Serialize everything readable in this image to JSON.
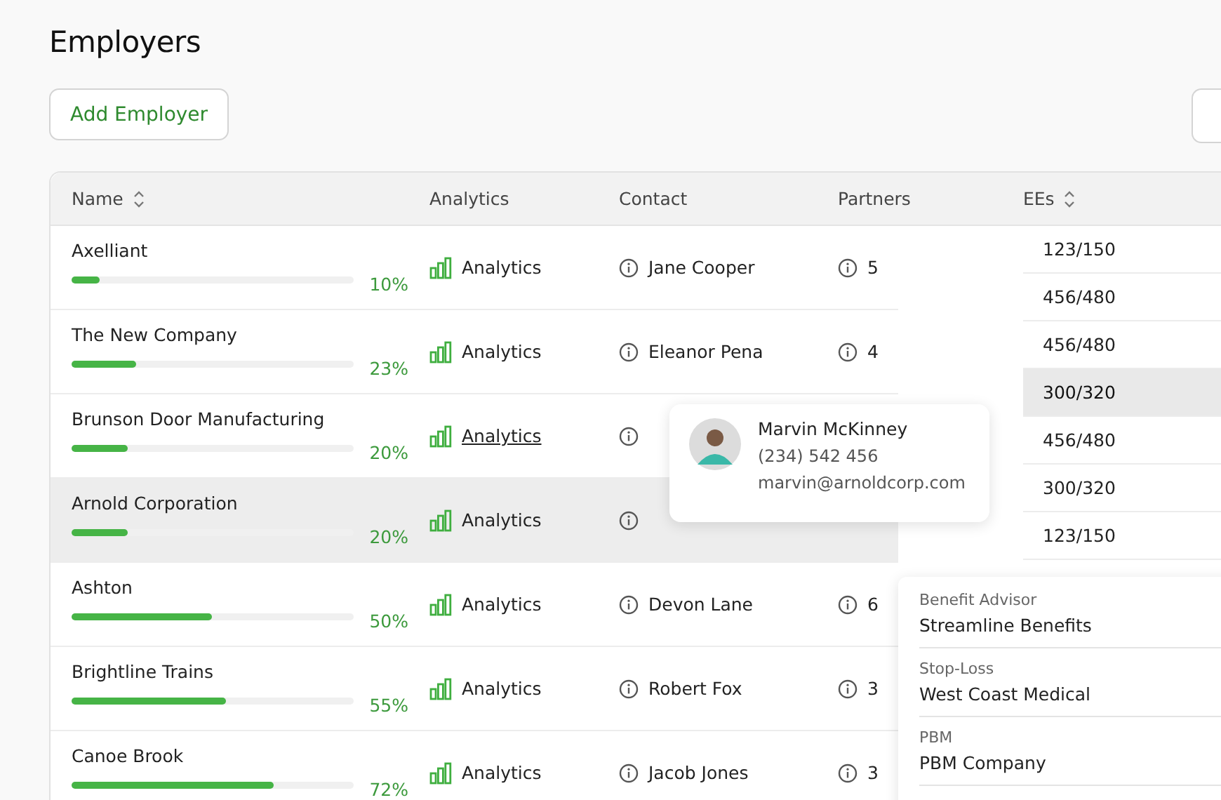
{
  "title": "Employers",
  "add_button": "Add Employer",
  "columns": [
    {
      "label": "Name",
      "sortable": true
    },
    {
      "label": "Analytics",
      "sortable": false
    },
    {
      "label": "Contact",
      "sortable": false
    },
    {
      "label": "Partners",
      "sortable": false
    },
    {
      "label": "EEs",
      "sortable": true
    }
  ],
  "rows": [
    {
      "name": "Axelliant",
      "level": 0.1,
      "percent": "10%",
      "analytics": "Analytics",
      "hovered": false,
      "contact": "Jane Cooper",
      "partners": "5",
      "selected": false
    },
    {
      "name": "The New Company",
      "level": 0.23,
      "percent": "23%",
      "analytics": "Analytics",
      "hovered": false,
      "contact": "Eleanor Pena",
      "partners": "4",
      "selected": false
    },
    {
      "name": "Brunson Door Manufacturing",
      "level": 0.2,
      "percent": "20%",
      "analytics": "Analytics",
      "hovered": true,
      "selected": false
    },
    {
      "name": "Arnold Corporation",
      "level": 0.2,
      "percent": "20%",
      "analytics": "Analytics",
      "hovered": false,
      "selected": true
    },
    {
      "name": "Ashton",
      "level": 0.5,
      "percent": "50%",
      "analytics": "Analytics",
      "hovered": false,
      "contact": "Devon Lane",
      "partners": "6",
      "selected": false
    },
    {
      "name": "Brightline Trains",
      "level": 0.55,
      "percent": "55%",
      "analytics": "Analytics",
      "hovered": false,
      "contact": "Robert Fox",
      "partners": "3",
      "selected": false
    },
    {
      "name": "Canoe Brook",
      "level": 0.72,
      "percent": "72%",
      "analytics": "Analytics",
      "hovered": false,
      "contact": "Jacob Jones",
      "partners": "3",
      "selected": false
    }
  ],
  "ees": [
    {
      "value": "123/150",
      "selected": false
    },
    {
      "value": "456/480",
      "selected": false
    },
    {
      "value": "456/480",
      "selected": false
    },
    {
      "value": "300/320",
      "selected": true
    },
    {
      "value": "456/480",
      "selected": false
    },
    {
      "value": "300/320",
      "selected": false
    },
    {
      "value": "123/150",
      "selected": false
    }
  ],
  "contact_popup": {
    "name": "Marvin McKinney",
    "phone": "(234) 542 456",
    "email": "marvin@arnoldcorp.com"
  },
  "partners_popup": [
    {
      "label": "Benefit Advisor",
      "value": "Streamline Benefits"
    },
    {
      "label": "Stop-Loss",
      "value": "West Coast Medical"
    },
    {
      "label": "PBM",
      "value": "PBM Company"
    }
  ]
}
